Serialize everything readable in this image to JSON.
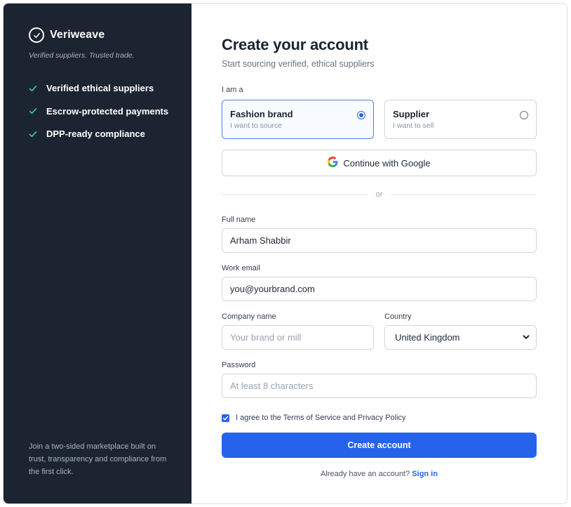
{
  "sidebar": {
    "brand_name": "Veriweave",
    "tagline": "Verified suppliers. Trusted trade.",
    "features": [
      "Verified ethical suppliers",
      "Escrow-protected payments",
      "DPP-ready compliance"
    ],
    "footer": "Join a two-sided marketplace built on trust, transparency and compliance from the first click."
  },
  "form": {
    "title": "Create your account",
    "subtitle": "Start sourcing verified, ethical suppliers",
    "role_label": "I am a",
    "roles": [
      {
        "title": "Fashion brand",
        "subtitle": "I want to source",
        "selected": true
      },
      {
        "title": "Supplier",
        "subtitle": "I want to sell",
        "selected": false
      }
    ],
    "google_button": "Continue with Google",
    "divider_text": "or",
    "full_name": {
      "label": "Full name",
      "value": "Arham Shabbir"
    },
    "work_email": {
      "label": "Work email",
      "value": "you@yourbrand.com"
    },
    "company_name": {
      "label": "Company name",
      "placeholder": "Your brand or mill"
    },
    "country": {
      "label": "Country",
      "value": "United Kingdom"
    },
    "password": {
      "label": "Password",
      "placeholder": "At least 8 characters"
    },
    "agree_text": "I agree to the Terms of Service and Privacy Policy",
    "agree_checked": true,
    "submit_label": "Create account",
    "signin_prompt": "Already have an account?",
    "signin_link": "Sign in"
  },
  "colors": {
    "sidebar_bg": "#1b2430",
    "accent": "#2563eb",
    "check_green": "#34d399"
  }
}
